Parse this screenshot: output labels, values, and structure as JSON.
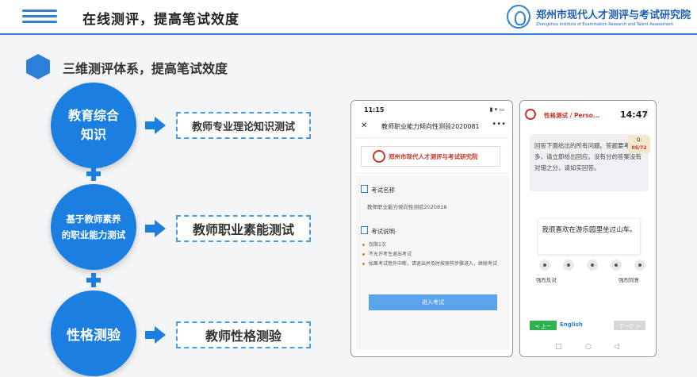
{
  "header": {
    "title": "在线测评，提高笔试效度",
    "org_cn": "郑州市现代人才测评与考试研究院",
    "org_en": "Zhengzhou Institute of Examination Research and Talent Assessment"
  },
  "section": {
    "title": "三维测评体系，提高笔试效度"
  },
  "dimensions": [
    {
      "circle_line1": "教育综合",
      "circle_line2": "知识",
      "box": "教师专业理论知识测试"
    },
    {
      "circle_line1": "基于教师素养",
      "circle_line2": "的职业能力测试",
      "box": "教师职业素能测试"
    },
    {
      "circle_line1": "性格测验",
      "circle_line2": "",
      "box": "教师性格测验"
    }
  ],
  "phone1": {
    "status_time": "11:15",
    "status_right": "▮ ▾ ▭",
    "close": "✕",
    "title": "教师职业能力倾向性测验2020081",
    "more": "•••",
    "banner_name": "郑州市现代人才测评与考试研究院",
    "exam_name_label": "考试名称",
    "exam_name_value": "教师职业能力倾向性测验2020818",
    "exam_desc_label": "考试说明",
    "notes": [
      "仅限1次",
      "不允许考生退出考试",
      "如果考试意外中断，请退出并及时按原样步骤进入，继续考试"
    ],
    "button": "进入考试"
  },
  "phone2": {
    "title": "性格测试 / Perso...",
    "time": "14:47",
    "more": "⋮",
    "question": "回答下面给出的所有问题。答题要考虑太多，请立即给出回应。没有分的答案没有对错之分，请如实回答。",
    "badge_label": "Q:",
    "badge_num": "05/72",
    "statement": "我很喜欢在游乐园里坐过山车。",
    "left_label": "强烈反对",
    "right_label": "强烈同意",
    "prev": "< 上一",
    "language": "English",
    "next": "下一个 >",
    "nav_back": "□",
    "nav_home": "○",
    "nav_recent": "◁"
  }
}
